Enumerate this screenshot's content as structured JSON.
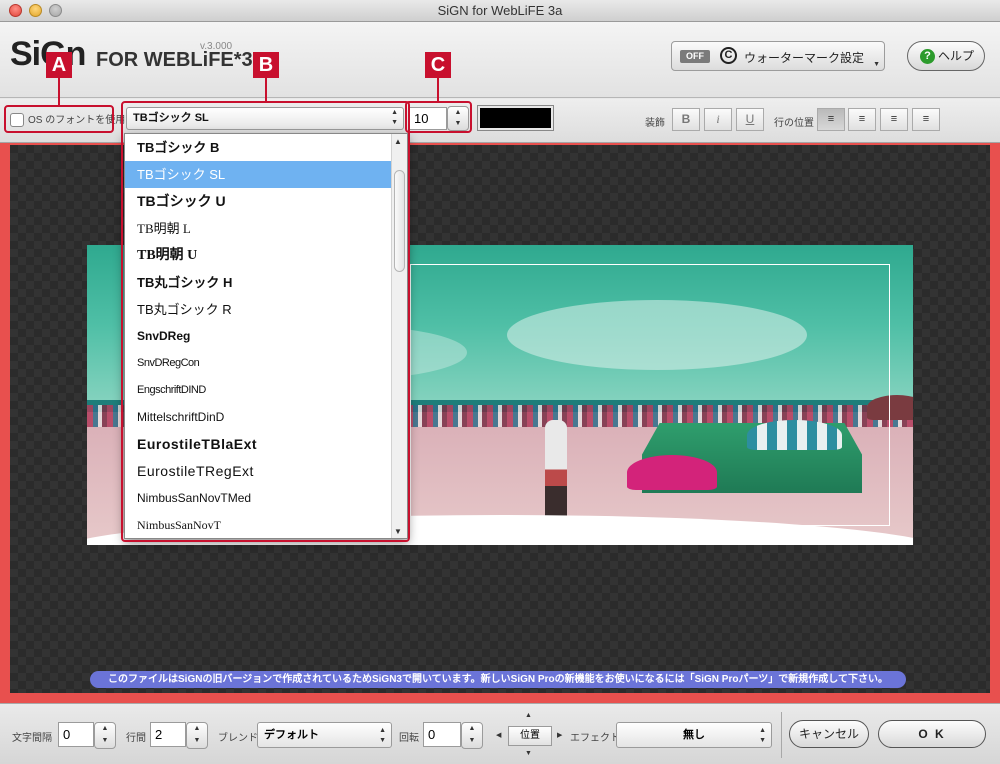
{
  "window": {
    "title": "SiGN for WebLiFE 3a"
  },
  "header": {
    "logo_main": "SiGn",
    "logo_sub": "FOR WEBLiFE*3",
    "version": "v.3.000",
    "watermark": {
      "state": "OFF",
      "label": "ウォーターマーク設定"
    },
    "help_label": "ヘルプ"
  },
  "toolbar": {
    "os_font_label": "OS のフォントを使用",
    "font_selected": "TBゴシック SL",
    "font_size": "10",
    "color": "#000000",
    "decoration_label": "装飾",
    "bold": "B",
    "italic": "i",
    "underline": "U",
    "line_position_label": "行の位置",
    "align_active": "left"
  },
  "font_list": [
    "TBゴシック B",
    "TBゴシック SL",
    "TBゴシック U",
    "TB明朝 L",
    "TB明朝 U",
    "TB丸ゴシック H",
    "TB丸ゴシック R",
    "SnvDReg",
    "SnvDRegCon",
    "EngschriftDIND",
    "MittelschriftDinD",
    "EurostileTBlaExt",
    "EurostileTRegExt",
    "NimbusSanNovTMed",
    "NimbusSanNovT"
  ],
  "callouts": [
    "A",
    "B",
    "C"
  ],
  "notice": "このファイルはSiGNの旧バージョンで作成されているためSiGN3で開いています。新しいSiGN Proの新機能をお使いになるには「SiGN Proパーツ」で新規作成して下さい。",
  "bottom": {
    "letter_spacing_label": "文字間隔",
    "letter_spacing": "0",
    "line_spacing_label": "行間",
    "line_spacing": "2",
    "blend_label": "ブレンド",
    "blend": "デフォルト",
    "rotation_label": "回転",
    "rotation": "0",
    "position_label": "位置",
    "effect_label": "エフェクト",
    "effect": "無し",
    "cancel": "キャンセル",
    "ok": "O K"
  },
  "colors": {
    "accent_red": "#c8102e",
    "canvas_border": "#e8504e",
    "selection": "#6fb2f1",
    "notice_bg": "#6b74d8",
    "help_green": "#2c9b2c"
  }
}
